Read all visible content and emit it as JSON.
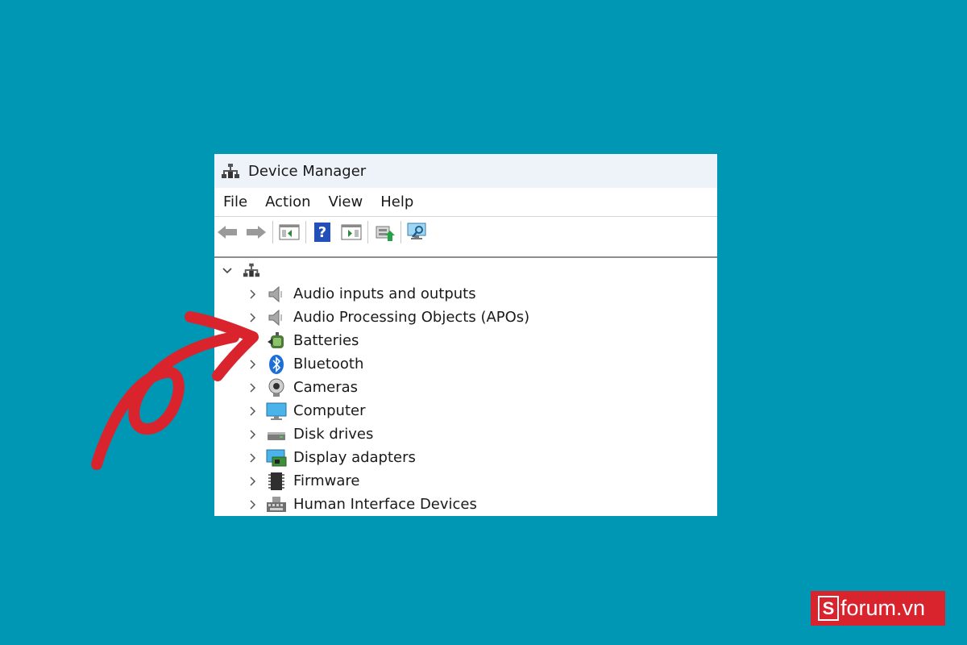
{
  "window": {
    "title": "Device Manager"
  },
  "menu": [
    "File",
    "Action",
    "View",
    "Help"
  ],
  "toolbar": {
    "buttons": [
      "back-arrow-icon",
      "forward-arrow-icon",
      "show-hide-console-tree-icon",
      "help-icon",
      "action-pane-icon",
      "update-driver-icon",
      "scan-hardware-icon"
    ]
  },
  "tree": {
    "root_icon": "computer-tower-icon",
    "items": [
      {
        "label": "Audio inputs and outputs",
        "icon": "speaker-icon"
      },
      {
        "label": "Audio Processing Objects (APOs)",
        "icon": "speaker-icon"
      },
      {
        "label": "Batteries",
        "icon": "battery-icon"
      },
      {
        "label": "Bluetooth",
        "icon": "bluetooth-icon"
      },
      {
        "label": "Cameras",
        "icon": "camera-icon"
      },
      {
        "label": "Computer",
        "icon": "monitor-icon"
      },
      {
        "label": "Disk drives",
        "icon": "disk-drive-icon"
      },
      {
        "label": "Display adapters",
        "icon": "display-adapter-icon"
      },
      {
        "label": "Firmware",
        "icon": "firmware-chip-icon"
      },
      {
        "label": "Human Interface Devices",
        "icon": "hid-keyboard-icon"
      }
    ]
  },
  "logo": {
    "text": "forum.vn",
    "letter": "S"
  },
  "colors": {
    "background": "#0097b4",
    "arrow": "#d9232d",
    "logo_bg": "#d9232d"
  }
}
